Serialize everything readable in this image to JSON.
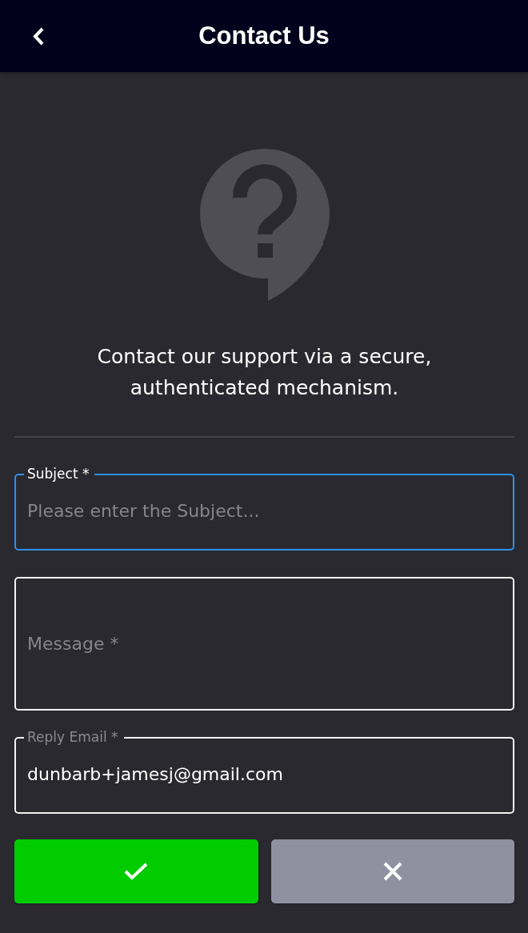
{
  "header": {
    "title": "Contact Us"
  },
  "intro": {
    "text": "Contact our support via a secure, authenticated mechanism."
  },
  "fields": [
    {
      "kind": "line",
      "label": "Subject *",
      "placeholder": "Please enter the Subject...",
      "focused": true
    },
    {
      "kind": "multiline",
      "placeholder": "Message *",
      "focused": false
    },
    {
      "kind": "line",
      "label": "Reply Email *",
      "value": "dunbarb+jamesj@gmail.com",
      "focused": false
    }
  ],
  "buttons": [
    {
      "kind": "confirm"
    },
    {
      "kind": "cancel"
    }
  ]
}
